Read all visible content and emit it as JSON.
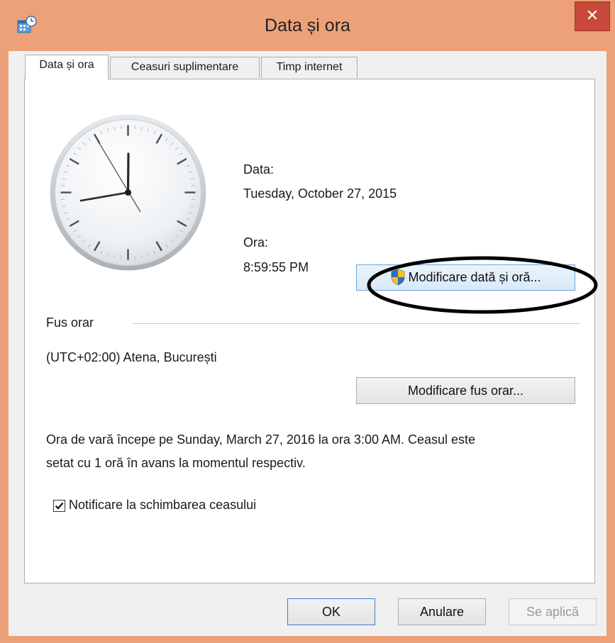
{
  "window": {
    "title": "Data și ora",
    "close_label": "✕"
  },
  "tabs": [
    {
      "label": "Data și ora",
      "active": true
    },
    {
      "label": "Ceasuri suplimentare",
      "active": false
    },
    {
      "label": "Timp internet",
      "active": false
    }
  ],
  "datetime": {
    "date_label": "Data:",
    "date_value": "Tuesday, October 27, 2015",
    "time_label": "Ora:",
    "time_value": "8:59:55 PM",
    "change_button": "Modificare dată și oră..."
  },
  "timezone": {
    "group_label": "Fus orar",
    "value": "(UTC+02:00) Atena, București",
    "change_button": "Modificare fus orar..."
  },
  "dst_info": {
    "line1": "Ora de vară începe pe Sunday, March 27, 2016 la ora 3:00 AM. Ceasul este",
    "line2": "setat cu 1 oră în avans la momentul respectiv."
  },
  "notify": {
    "label": "Notificare la schimbarea ceasului",
    "checked": true
  },
  "buttons": {
    "ok": "OK",
    "cancel": "Anulare",
    "apply": "Se aplică"
  },
  "colors": {
    "frame": "#eda178",
    "close": "#c74a3a",
    "shield_blue": "#2f6fc8",
    "shield_yellow": "#f2c21b"
  },
  "icons": {
    "app": "calendar-clock-icon",
    "uac": "uac-shield-icon"
  }
}
